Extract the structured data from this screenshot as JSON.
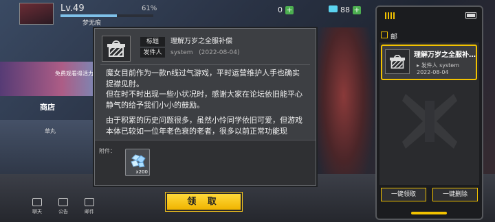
{
  "player": {
    "level": "Lv.49",
    "exp_percent_text": "61%",
    "exp_progress": 0.61,
    "name": "梦无痕"
  },
  "currency": {
    "coin": "0",
    "gems": "88"
  },
  "left_menu": {
    "ad_text": "免费观看得活力",
    "shop_label": "商店",
    "side_text": "草丸"
  },
  "bottom_bar": {
    "chat": "聊天",
    "notice": "公告",
    "mail": "邮件"
  },
  "dialog": {
    "title_label": "标题",
    "title": "理解万岁之全服补偿",
    "sender_label": "发件人",
    "sender": "system",
    "date": "(2022-08-04)",
    "body_p1": "魔女目前作为一款n线过气游戏，平时运营维护人手也确实捉襟见肘。",
    "body_p2": "但在时不时出现一些小状况时，感谢大家在论坛依旧能平心静气的给予我们小小的鼓励。",
    "body_p3": "由于积累的历史问题很多，虽然小怜同学依旧可爱，但游戏本体已较如一位年老色衰的老者，很多以前正常功能现",
    "attachment_label": "附件：",
    "attachment_qty": "x200"
  },
  "claim_button": "领 取",
  "mail_panel": {
    "header": "邮件",
    "items": [
      {
        "title": "理解万岁之全服补…",
        "sender": "发件人 system",
        "date": "2022-08-04"
      }
    ],
    "claim_all": "一键领取",
    "delete_all": "一键删除"
  },
  "colors": {
    "accent": "#f2c200",
    "exp_bar": "#7fc1e9",
    "dialog_bg": "#3d3f43"
  }
}
